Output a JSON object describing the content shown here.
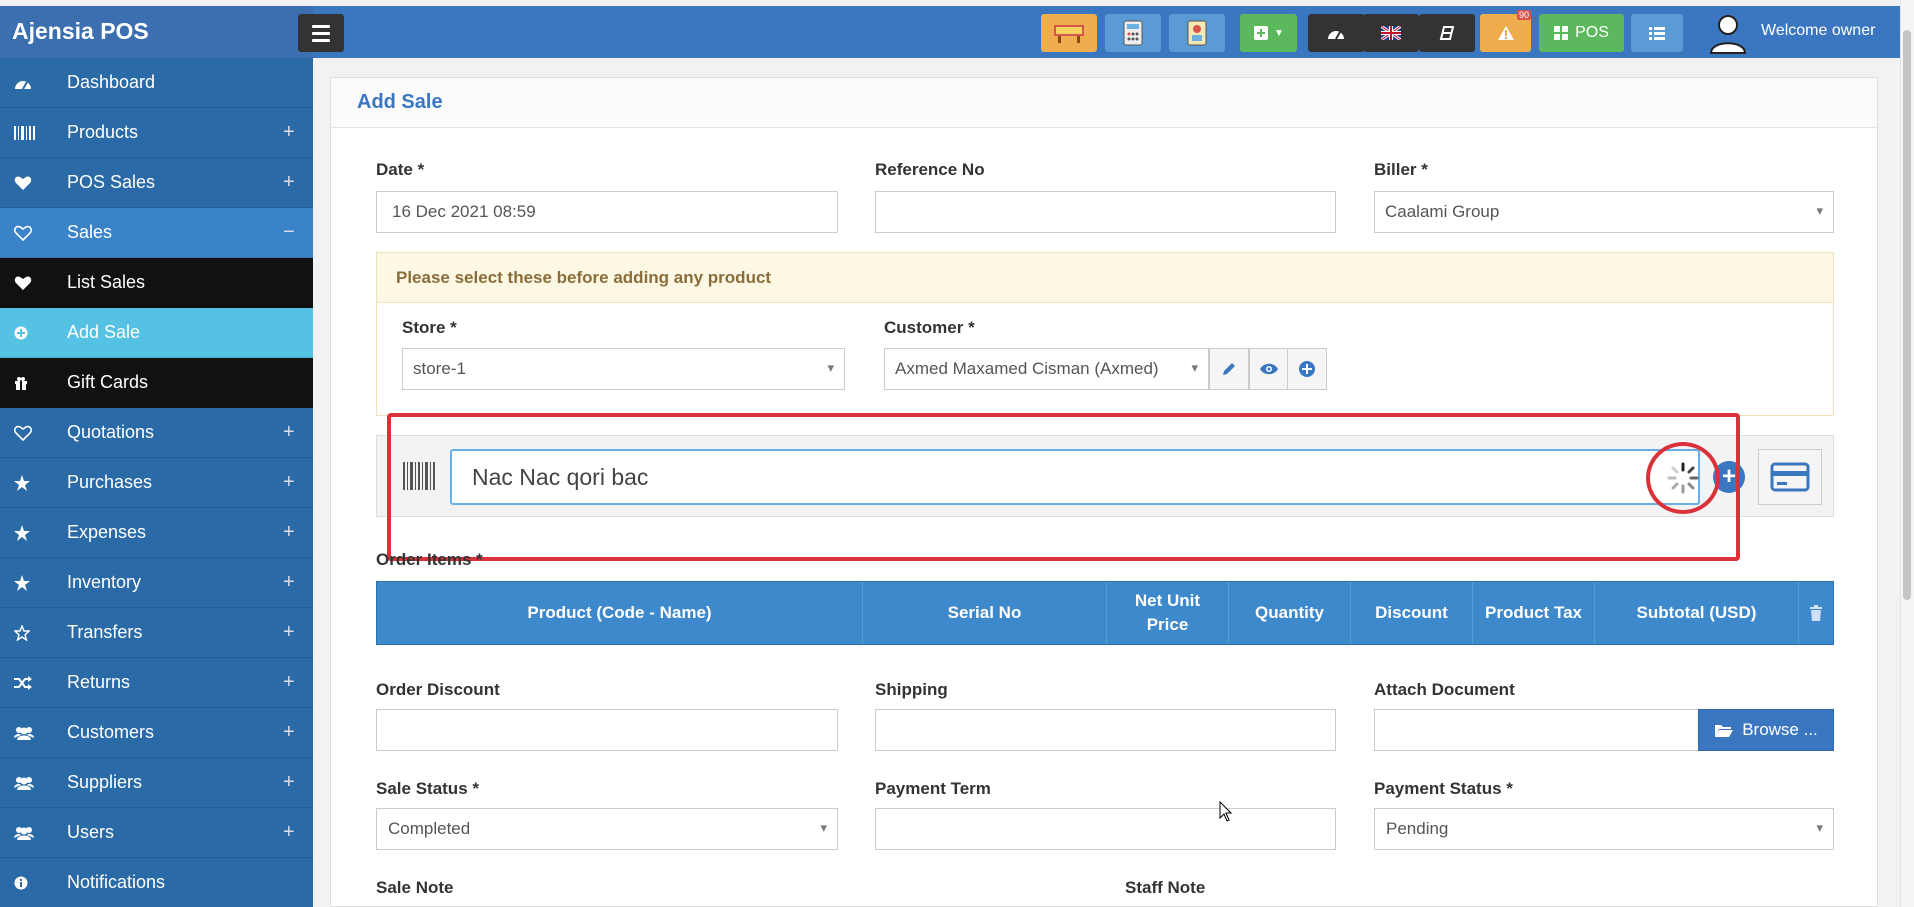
{
  "app": {
    "title": "Ajensia POS",
    "welcome": "Welcome owner"
  },
  "topbar": {
    "pos_label": "POS",
    "alert_count": "90"
  },
  "sidebar": {
    "items": [
      {
        "label": "Dashboard",
        "icon": "dashboard-icon",
        "expand": ""
      },
      {
        "label": "Products",
        "icon": "barcode-icon",
        "expand": "+"
      },
      {
        "label": "POS Sales",
        "icon": "heart-icon",
        "expand": "+"
      },
      {
        "label": "Sales",
        "icon": "heart-outline-icon",
        "expand": "−"
      },
      {
        "label": "List Sales",
        "icon": "heart-icon",
        "expand": ""
      },
      {
        "label": "Add Sale",
        "icon": "plus-circle-icon",
        "expand": ""
      },
      {
        "label": "Gift Cards",
        "icon": "gift-icon",
        "expand": ""
      },
      {
        "label": "Quotations",
        "icon": "heart-outline-icon",
        "expand": "+"
      },
      {
        "label": "Purchases",
        "icon": "star-icon",
        "expand": "+"
      },
      {
        "label": "Expenses",
        "icon": "star-icon",
        "expand": "+"
      },
      {
        "label": "Inventory",
        "icon": "star-icon",
        "expand": "+"
      },
      {
        "label": "Transfers",
        "icon": "star-outline-icon",
        "expand": "+"
      },
      {
        "label": "Returns",
        "icon": "random-icon",
        "expand": "+"
      },
      {
        "label": "Customers",
        "icon": "users-icon",
        "expand": "+"
      },
      {
        "label": "Suppliers",
        "icon": "users-icon",
        "expand": "+"
      },
      {
        "label": "Users",
        "icon": "users-icon",
        "expand": "+"
      },
      {
        "label": "Notifications",
        "icon": "info-icon",
        "expand": ""
      }
    ]
  },
  "form": {
    "title": "Add Sale",
    "date_label": "Date *",
    "date_value": "16 Dec 2021 08:59",
    "reference_label": "Reference No",
    "reference_value": "",
    "biller_label": "Biller *",
    "biller_value": "Caalami Group",
    "notice": "Please select these before adding any product",
    "store_label": "Store *",
    "store_value": "store-1",
    "customer_label": "Customer *",
    "customer_value": "Axmed Maxamed Cisman (Axmed)",
    "product_search_value": "Nac Nac qori bac",
    "order_items_label": "Order Items *",
    "columns": [
      "Product (Code - Name)",
      "Serial No",
      "Net Unit Price",
      "Quantity",
      "Discount",
      "Product Tax",
      "Subtotal (USD)"
    ],
    "order_discount_label": "Order Discount",
    "shipping_label": "Shipping",
    "attach_label": "Attach Document",
    "browse_label": "Browse ...",
    "sale_status_label": "Sale Status *",
    "sale_status_value": "Completed",
    "payment_term_label": "Payment Term",
    "payment_status_label": "Payment Status *",
    "payment_status_value": "Pending",
    "sale_note_label": "Sale Note",
    "staff_note_label": "Staff Note"
  },
  "colors": {
    "primary": "#3b77c0",
    "sidebar": "#2d6ba8",
    "active_item": "#55c1e3",
    "highlight": "#d9323a"
  }
}
